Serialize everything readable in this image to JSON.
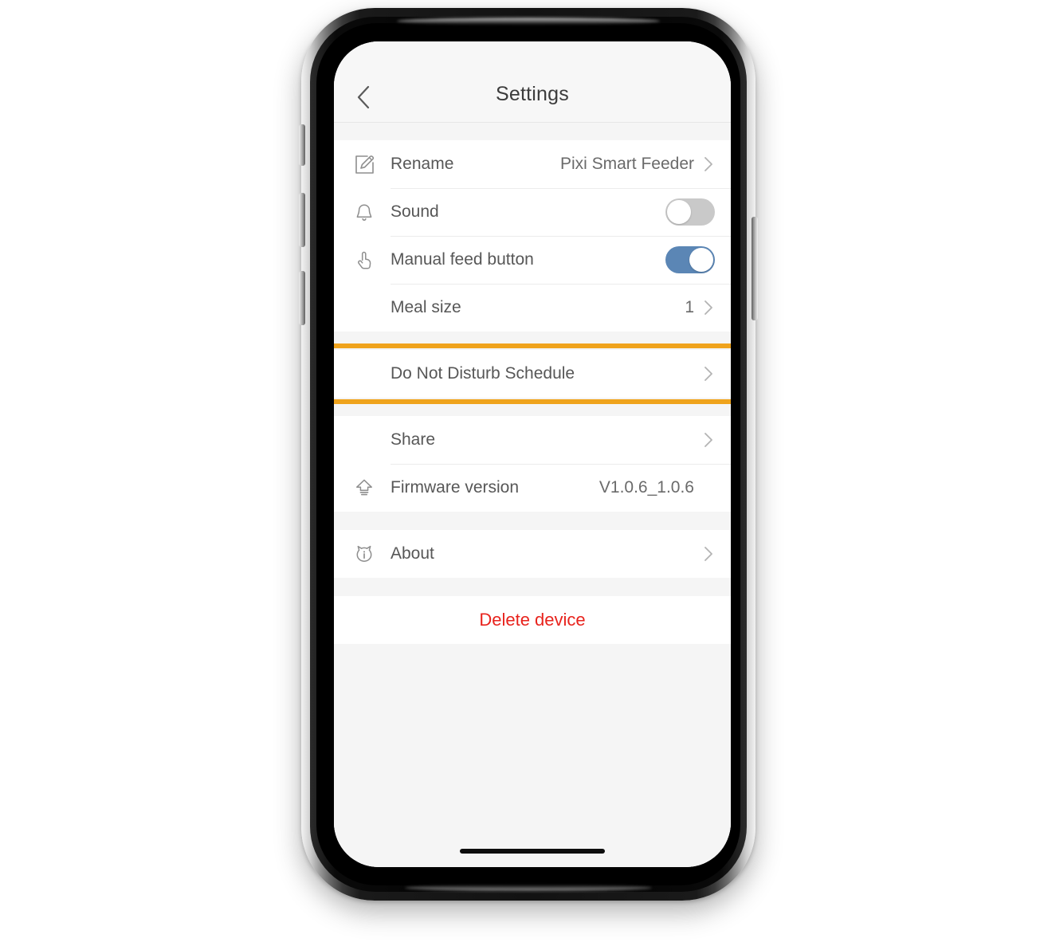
{
  "device": {
    "buttons": [
      {
        "name": "silent-switch",
        "side": "left"
      },
      {
        "name": "volume-up-button",
        "side": "left"
      },
      {
        "name": "volume-down-button",
        "side": "left"
      },
      {
        "name": "power-button",
        "side": "right"
      }
    ]
  },
  "nav": {
    "back_icon": "chevron-left-icon",
    "title": "Settings"
  },
  "colors": {
    "accent_toggle_on": "#5B86B5",
    "toggle_off": "#C9C9C9",
    "highlight_border": "#EFA31C",
    "destructive": "#E8231D",
    "label_text": "#575757",
    "value_text": "#6A6A6A",
    "page_background": "#F5F5F5",
    "row_background": "#FFFFFF"
  },
  "groups": [
    {
      "name": "device-settings-group",
      "rows": [
        {
          "id": "rename",
          "icon": "pencil-edit-icon",
          "label": "Rename",
          "value": "Pixi Smart Feeder",
          "control": "chevron"
        },
        {
          "id": "sound",
          "icon": "bell-icon",
          "label": "Sound",
          "control": "toggle",
          "toggle_state": "off"
        },
        {
          "id": "manual-feed-button",
          "icon": "hand-tap-icon",
          "label": "Manual feed button",
          "control": "toggle",
          "toggle_state": "on"
        },
        {
          "id": "meal-size",
          "icon": null,
          "label": "Meal size",
          "value": "1",
          "control": "chevron"
        }
      ]
    },
    {
      "name": "do-not-disturb-group",
      "highlighted": true,
      "rows": [
        {
          "id": "do-not-disturb-schedule",
          "icon": null,
          "label": "Do Not Disturb Schedule",
          "value": "",
          "control": "chevron"
        }
      ]
    },
    {
      "name": "share-firmware-group",
      "rows": [
        {
          "id": "share",
          "icon": null,
          "label": "Share",
          "value": "",
          "control": "chevron"
        },
        {
          "id": "firmware-version",
          "icon": "firmware-upload-icon",
          "label": "Firmware version",
          "value": "V1.0.6_1.0.6",
          "control": "none"
        }
      ]
    },
    {
      "name": "about-group",
      "rows": [
        {
          "id": "about",
          "icon": "cat-info-icon",
          "label": "About",
          "value": "",
          "control": "chevron"
        }
      ]
    }
  ],
  "delete": {
    "label": "Delete device"
  }
}
